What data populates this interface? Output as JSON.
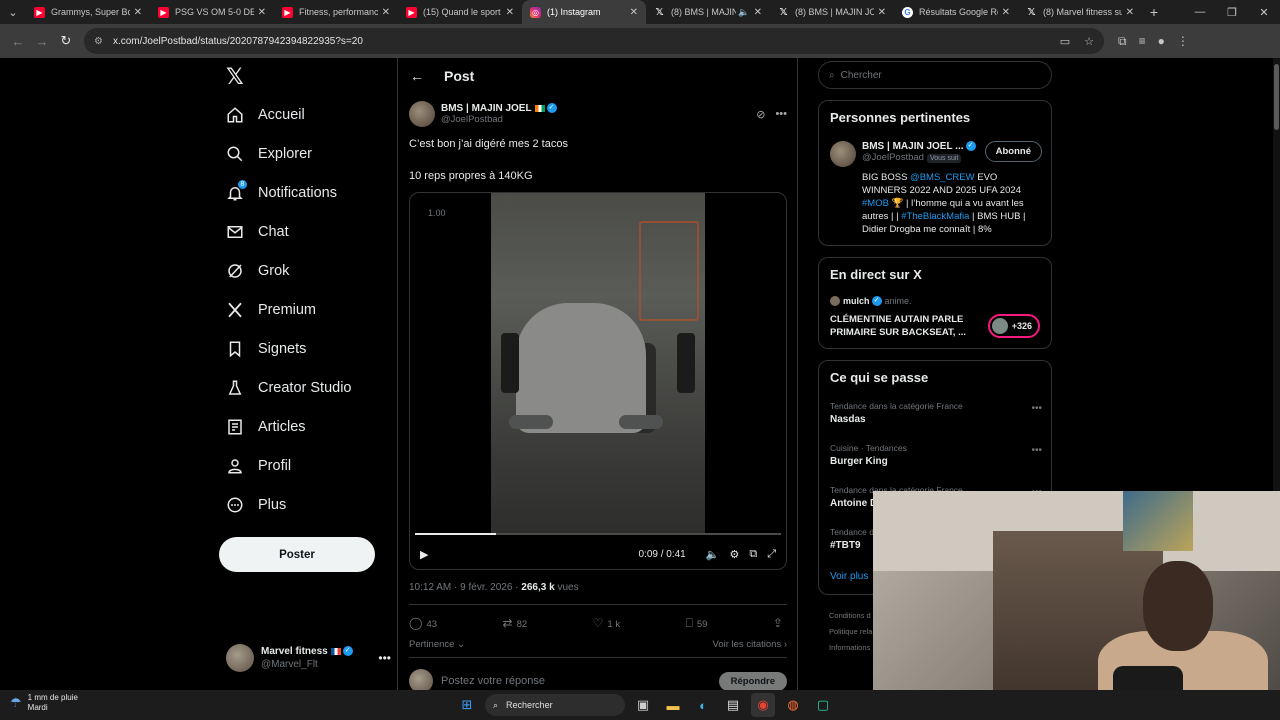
{
  "browser": {
    "tabs": [
      {
        "title": "Grammys, Super Bow",
        "icon": "youtube-icon",
        "active": false
      },
      {
        "title": "PSG VS OM 5-0 DEBR",
        "icon": "youtube-icon",
        "active": false
      },
      {
        "title": "Fitness, performance",
        "icon": "youtube-icon",
        "active": false
      },
      {
        "title": "(15) Quand le sport d",
        "icon": "youtube-icon",
        "active": false
      },
      {
        "title": "(1) Instagram",
        "icon": "instagram-icon",
        "active": true
      },
      {
        "title": "(8) BMS | MAJIN",
        "icon": "x-icon",
        "active": false
      },
      {
        "title": "(8) BMS | MAJIN JOE",
        "icon": "x-icon",
        "active": false
      },
      {
        "title": "Résultats Google Rec",
        "icon": "google-icon",
        "active": false
      },
      {
        "title": "(8) Marvel fitness sur",
        "icon": "x-icon",
        "active": false
      }
    ],
    "url": "x.com/JoelPostbad/status/2020787942394822935?s=20"
  },
  "nav": {
    "items": [
      {
        "label": "Accueil",
        "icon": "home-icon"
      },
      {
        "label": "Explorer",
        "icon": "search-icon"
      },
      {
        "label": "Notifications",
        "icon": "bell-icon",
        "badge": "8"
      },
      {
        "label": "Chat",
        "icon": "mail-icon"
      },
      {
        "label": "Grok",
        "icon": "grok-icon"
      },
      {
        "label": "Premium",
        "icon": "x-icon"
      },
      {
        "label": "Signets",
        "icon": "bookmark-icon"
      },
      {
        "label": "Creator Studio",
        "icon": "flask-icon"
      },
      {
        "label": "Articles",
        "icon": "article-icon"
      },
      {
        "label": "Profil",
        "icon": "person-icon"
      },
      {
        "label": "Plus",
        "icon": "more-circle-icon"
      }
    ],
    "post_button": "Poster",
    "account": {
      "name": "Marvel fitness",
      "handle": "@Marvel_Flt"
    }
  },
  "post": {
    "header": "Post",
    "author_name": "BMS | MAJIN JOEL",
    "author_handle": "@JoelPostbad",
    "text_line1": "C’est bon j’ai digéré mes 2 tacos",
    "text_line2": "10 reps propres à 140KG",
    "video": {
      "rate": "1.00",
      "time": "0:09 / 0:41",
      "progress": 0.22
    },
    "meta_time": "10:12 AM · 9 févr. 2026 · ",
    "views_count": "266,3 k",
    "views_label": " vues",
    "stats": {
      "replies": "43",
      "reposts": "82",
      "likes": "1 k",
      "bookmarks": "59"
    },
    "sort_label": "Pertinence",
    "quotes_label": "Voir les citations",
    "reply_placeholder": "Postez votre réponse",
    "reply_button": "Répondre"
  },
  "sidebar": {
    "search_placeholder": "Chercher",
    "relevant": {
      "title": "Personnes pertinentes",
      "name": "BMS | MAJIN JOEL ...",
      "handle": "@JoelPostbad",
      "follows_you": "Vous suit",
      "follow_button": "Abonné",
      "bio_1": "BIG BOSS ",
      "bio_link1": "@BMS_CREW",
      "bio_2": " EVO WINNERS 2022 AND 2025 UFA 2024 ",
      "bio_link2": "#MOB",
      "bio_3": " 🏆 | l’homme qui a vu avant les autres | | ",
      "bio_link3": "#TheBlackMafia",
      "bio_4": " | BMS HUB | Didier Drogba me connaît | 8%"
    },
    "live": {
      "title": "En direct sur X",
      "host": "mulch",
      "status": "anime.",
      "space_title": "CLÉMENTINE AUTAIN PARLE PRIMAIRE SUR BACKSEAT, ...",
      "listeners": "+326"
    },
    "trends": {
      "title": "Ce qui se passe",
      "items": [
        {
          "category": "Tendance dans la catégorie France",
          "name": "Nasdas"
        },
        {
          "category": "Cuisine · Tendances",
          "name": "Burger King"
        },
        {
          "category": "Tendance dans la catégorie France",
          "name": "Antoine D"
        },
        {
          "category": "Tendance d",
          "name": "#TBT9"
        }
      ],
      "see_more": "Voir plus"
    },
    "footer": [
      "Conditions d",
      "Politique rela",
      "Informations"
    ]
  },
  "taskbar": {
    "weather_line1": "1 mm de pluie",
    "weather_line2": "Mardi",
    "search_label": "Rechercher"
  }
}
